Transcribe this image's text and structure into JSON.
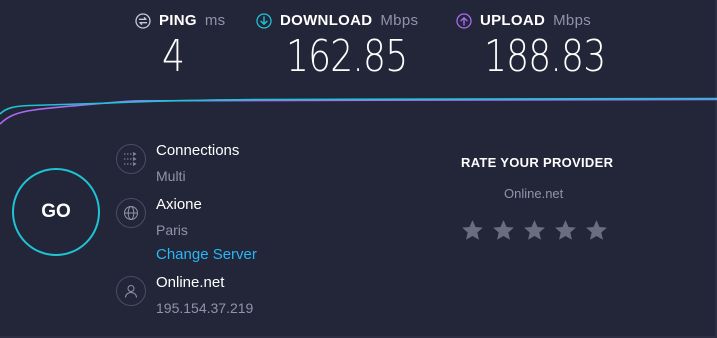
{
  "metrics": {
    "ping": {
      "label": "PING",
      "unit": "ms",
      "value": "4",
      "icon": "ping-icon"
    },
    "download": {
      "label": "DOWNLOAD",
      "unit": "Mbps",
      "value": "162.85",
      "icon": "download-arrow-icon",
      "color": "#1fc3d6"
    },
    "upload": {
      "label": "UPLOAD",
      "unit": "Mbps",
      "value": "188.83",
      "icon": "upload-arrow-icon",
      "color": "#a86cf0"
    }
  },
  "go_button": {
    "label": "GO",
    "color": "#1fc3d6"
  },
  "info": {
    "connections": {
      "title": "Connections",
      "value": "Multi",
      "icon": "connections-icon"
    },
    "server": {
      "title": "Axione",
      "location": "Paris",
      "change_link": "Change Server",
      "icon": "globe-icon"
    },
    "provider": {
      "title": "Online.net",
      "ip": "195.154.37.219",
      "icon": "user-icon"
    }
  },
  "rating": {
    "title": "RATE YOUR PROVIDER",
    "provider": "Online.net",
    "stars": 5,
    "rating": 0
  },
  "colors": {
    "background": "#232538",
    "accent_cyan": "#1fc3d6",
    "accent_purple": "#a86cf0",
    "link": "#29b6f6",
    "muted": "#9194a8"
  }
}
